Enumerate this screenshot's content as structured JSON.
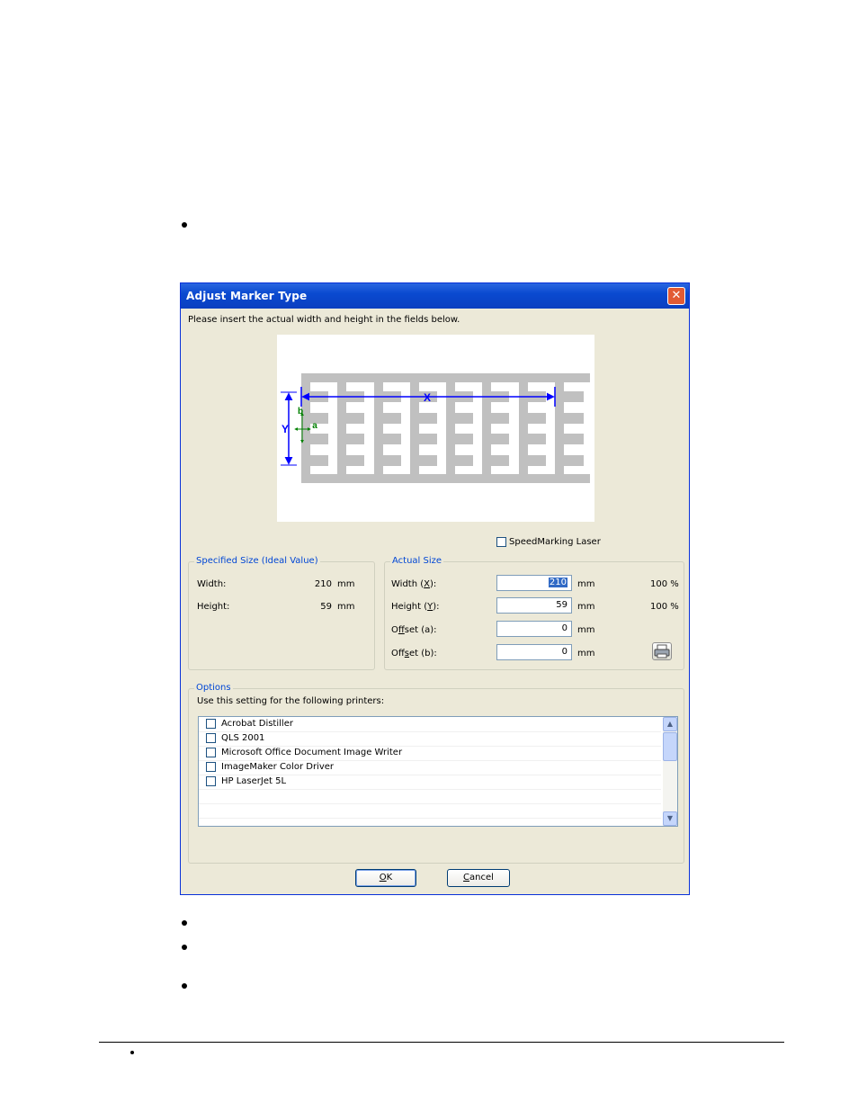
{
  "dialog": {
    "title": "Adjust Marker Type",
    "close_symbol": "✕",
    "instruction": "Please insert the actual width and height in the fields below.",
    "diagram_labels": {
      "x": "X",
      "y": "Y",
      "a": "a",
      "b": "b"
    },
    "speedmarking_label": "SpeedMarking Laser",
    "speedmarking_checked": false,
    "specified": {
      "legend": "Specified Size (Ideal Value)",
      "width_label": "Width:",
      "width_value": "210",
      "width_unit": "mm",
      "height_label": "Height:",
      "height_value": "59",
      "height_unit": "mm"
    },
    "actual": {
      "legend": "Actual Size",
      "width_label_pre": "Width (",
      "width_label_key": "X",
      "width_label_post": "):",
      "width_value": "210",
      "width_unit": "mm",
      "width_percent": "100 %",
      "height_label_pre": "Height (",
      "height_label_key": "Y",
      "height_label_post": "):",
      "height_value": "59",
      "height_unit": "mm",
      "height_percent": "100 %",
      "offset_a_label_pre": "O",
      "offset_a_label_key": "f",
      "offset_a_label_post": "fset (a):",
      "offset_a_value": "0",
      "offset_a_unit": "mm",
      "offset_b_label_pre": "Off",
      "offset_b_label_key": "s",
      "offset_b_label_post": "et (b):",
      "offset_b_value": "0",
      "offset_b_unit": "mm"
    },
    "options": {
      "legend": "Options",
      "description": "Use this setting for the following printers:",
      "printers": [
        {
          "name": "Acrobat Distiller",
          "checked": false
        },
        {
          "name": "QLS 2001",
          "checked": false
        },
        {
          "name": "Microsoft Office Document Image Writer",
          "checked": false
        },
        {
          "name": "ImageMaker Color Driver",
          "checked": false
        },
        {
          "name": "HP LaserJet 5L",
          "checked": false
        }
      ]
    },
    "ok_key": "O",
    "ok_rest": "K",
    "cancel_key": "C",
    "cancel_rest": "ancel"
  },
  "colors": {
    "title_bar": "#0a4ad0",
    "dialog_bg": "#ece9d8",
    "legend_text": "#0046d5",
    "dimension_blue": "#0000ff",
    "offset_green": "#008000",
    "label_gray": "#c0c0c0"
  }
}
